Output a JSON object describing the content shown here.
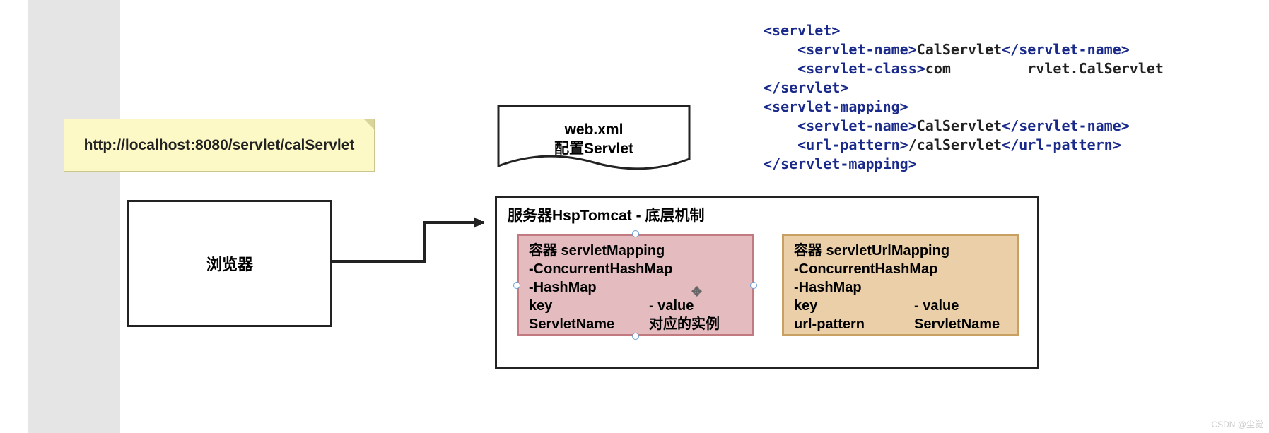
{
  "sticky": {
    "url": "http://localhost:8080/servlet/calServlet"
  },
  "browser": {
    "label": "浏览器"
  },
  "webxml": {
    "line1": "web.xml",
    "line2": "配置Servlet"
  },
  "server": {
    "title": "服务器HspTomcat - 底层机制",
    "box1": {
      "title": "容器 servletMapping",
      "line2": "-ConcurrentHashMap",
      "line3": "-HashMap",
      "key_label": "key",
      "val_label": "- value",
      "key_val": "ServletName",
      "val_val": "对应的实例"
    },
    "box2": {
      "title": "容器 servletUrlMapping",
      "line2": "-ConcurrentHashMap",
      "line3": "-HashMap",
      "key_label": "key",
      "val_label": "- value",
      "key_val": "url-pattern",
      "val_val": "ServletName"
    }
  },
  "xml": {
    "l1_open": "<servlet>",
    "l2_open": "<servlet-name>",
    "l2_txt": "CalServlet",
    "l2_close": "</servlet-name>",
    "l3_open": "<servlet-class>",
    "l3_txt1": "com",
    "l3_txt2": "rvlet.CalServlet",
    "l3_close": "",
    "l4_close": "</servlet>",
    "l5_open": "<servlet-mapping>",
    "l6_open": "<servlet-name>",
    "l6_txt": "CalServlet",
    "l6_close": "</servlet-name>",
    "l7_open": "<url-pattern>",
    "l7_txt": "/calServlet",
    "l7_close": "</url-pattern>",
    "l8_close": "</servlet-mapping>"
  },
  "watermark": "CSDN @尘觉"
}
